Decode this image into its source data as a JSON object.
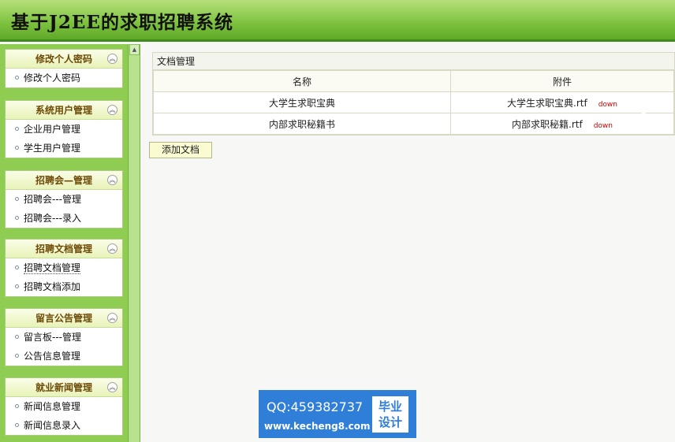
{
  "header": {
    "title": "基于J2EE的求职招聘系统"
  },
  "sidebar": {
    "groups": [
      {
        "title": "修改个人密码",
        "items": [
          "修改个人密码"
        ]
      },
      {
        "title": "系统用户管理",
        "items": [
          "企业用户管理",
          "学生用户管理"
        ]
      },
      {
        "title": "招聘会—管理",
        "items": [
          "招聘会---管理",
          "招聘会---录入"
        ]
      },
      {
        "title": "招聘文档管理",
        "items": [
          "招聘文档管理",
          "招聘文档添加"
        ]
      },
      {
        "title": "留言公告管理",
        "items": [
          "留言板---管理",
          "公告信息管理"
        ]
      },
      {
        "title": "就业新闻管理",
        "items": [
          "新闻信息管理",
          "新闻信息录入"
        ]
      }
    ],
    "collapse_icon": "double-chevron-up-icon"
  },
  "main": {
    "panel_title": "文档管理",
    "columns": [
      "名称",
      "附件"
    ],
    "rows": [
      {
        "name": "大学生求职宝典",
        "attachment": "大学生求职宝典.rtf",
        "action": "down"
      },
      {
        "name": "内部求职秘籍书",
        "attachment": "内部求职秘籍.rtf",
        "action": "down"
      }
    ],
    "add_button": "添加文档"
  },
  "watermark": {
    "qq": "QQ:459382737",
    "url": "www.kecheng8.com",
    "badge_line1": "毕业",
    "badge_line2": "设计"
  },
  "colors": {
    "header_green": "#7cc13e",
    "sidebar_green": "#8fcd52",
    "link_red": "#cc0000",
    "watermark_blue": "#2f7ed8"
  }
}
